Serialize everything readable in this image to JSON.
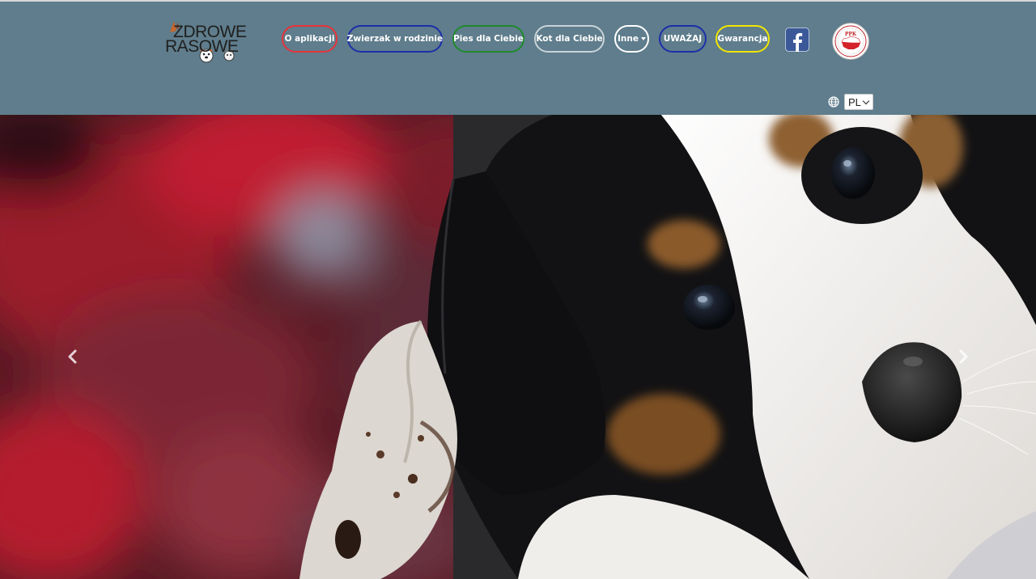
{
  "logo": {
    "line1": "ZDROWE",
    "line2": "RASOWE"
  },
  "nav": {
    "items": [
      {
        "label": "O aplikacji",
        "color": "#e8333a"
      },
      {
        "label": "Zwierzak w rodzinie",
        "color": "#1c2fa8"
      },
      {
        "label": "Pies dla Ciebie",
        "color": "#1f8a2c"
      },
      {
        "label": "Kot dla Ciebie",
        "color": "#c9d3d8"
      },
      {
        "label": "Inne",
        "color": "#ffffff"
      },
      {
        "label": "UWAŻAJ",
        "color": "#1c2fa8"
      },
      {
        "label": "Gwarancja",
        "color": "#f2e600"
      }
    ]
  },
  "ppk_badge": {
    "text": "PPK"
  },
  "language": {
    "selected": "PL"
  },
  "icons": [
    "zdrowe-rasowe-logo",
    "facebook-icon",
    "ppk-badge",
    "globe-icon",
    "carousel-prev-icon",
    "carousel-next-icon"
  ],
  "colors": {
    "header_bg": "#5f7d8c",
    "facebook": "#3b5998"
  }
}
